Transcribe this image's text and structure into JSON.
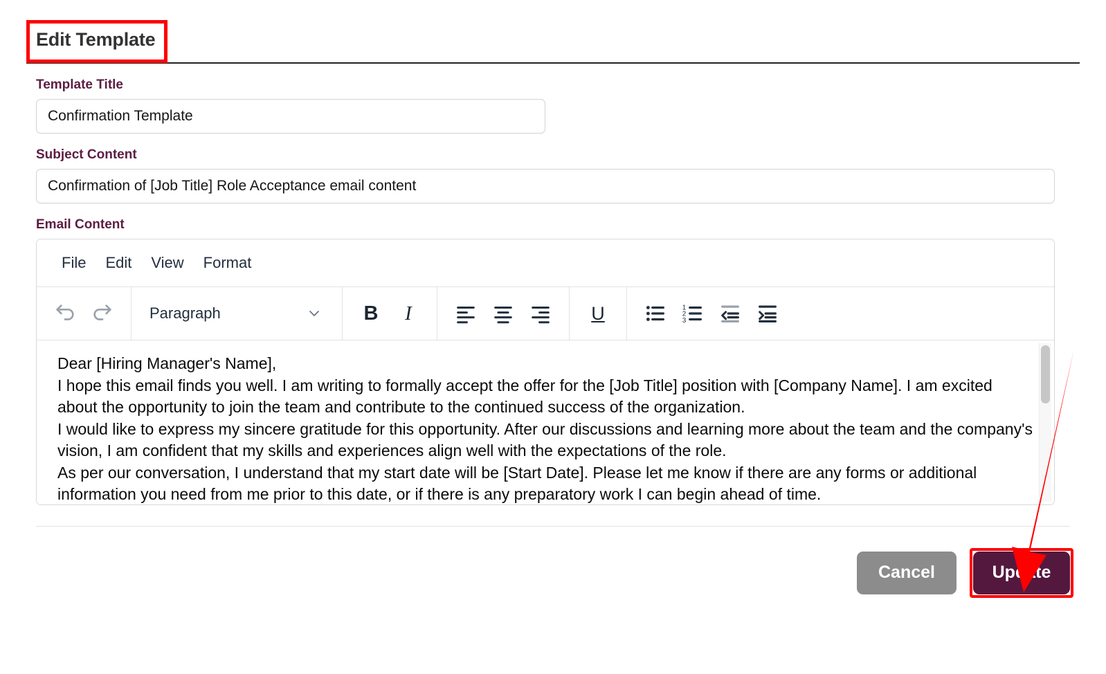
{
  "modal": {
    "title": "Edit Template",
    "highlight_color": "#ff0000",
    "accent_color": "#5c1d43"
  },
  "form": {
    "template_title": {
      "label": "Template Title",
      "value": "Confirmation Template",
      "placeholder": "Template Title"
    },
    "subject_content": {
      "label": "Subject Content",
      "value": "Confirmation of [Job Title] Role Acceptance email content",
      "placeholder": "Subject Content"
    },
    "email_content": {
      "label": "Email Content"
    }
  },
  "editor": {
    "menu": [
      {
        "label": "File",
        "name": "menu-file"
      },
      {
        "label": "Edit",
        "name": "menu-edit"
      },
      {
        "label": "View",
        "name": "menu-view"
      },
      {
        "label": "Format",
        "name": "menu-format"
      }
    ],
    "toolbar": {
      "undo": "undo-icon",
      "redo": "redo-icon",
      "format_select_value": "Paragraph",
      "bold": "B",
      "italic": "I",
      "underline": "U",
      "align_left": "align-left-icon",
      "align_center": "align-center-icon",
      "align_right": "align-right-icon",
      "bullet_list": "bullet-list-icon",
      "numbered_list": "numbered-list-icon",
      "outdent": "outdent-icon",
      "indent": "indent-icon"
    },
    "content_lines": [
      "Dear [Hiring Manager's Name],",
      "I hope this email finds you well. I am writing to formally accept the offer for the [Job Title] position with [Company Name]. I am excited about the opportunity to join the team and contribute to the continued success of the organization.",
      "I would like to express my sincere gratitude for this opportunity. After our discussions and learning more about the team and the company's vision, I am confident that my skills and experiences align well with the expectations of the role.",
      "As per our conversation, I understand that my start date will be [Start Date]. Please let me know if there are any forms or additional information you need from me prior to this date, or if there is any preparatory work I can begin ahead of time."
    ]
  },
  "footer": {
    "cancel_label": "Cancel",
    "update_label": "Update"
  }
}
